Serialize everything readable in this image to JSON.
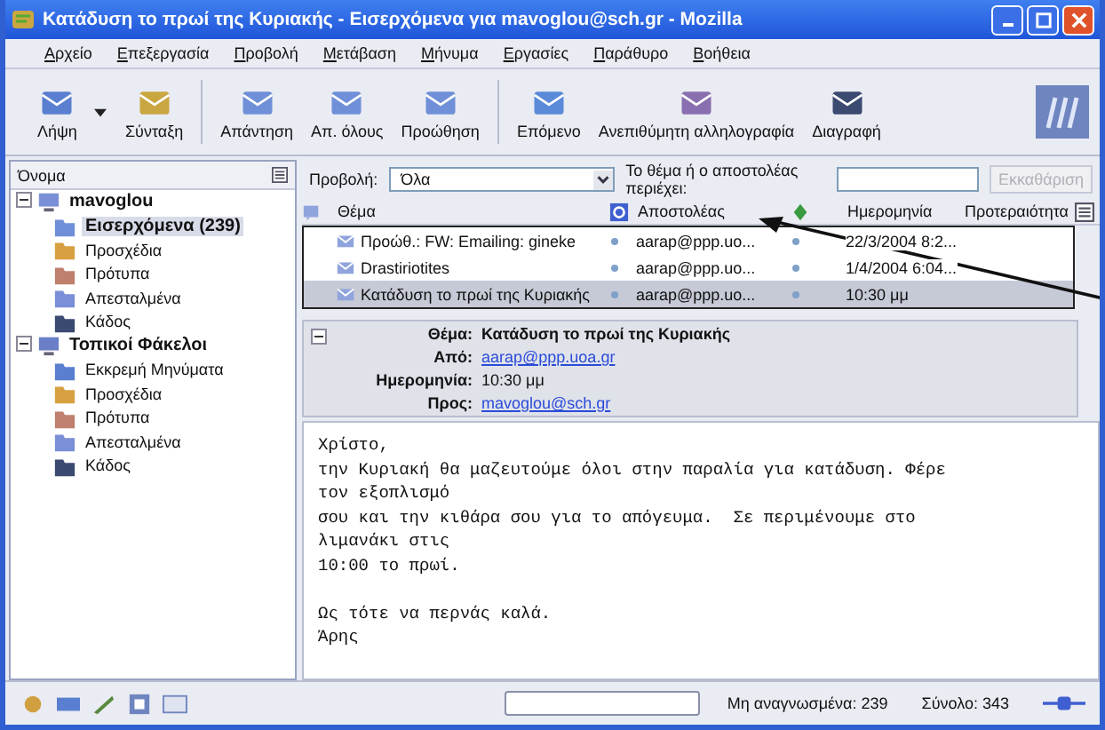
{
  "window": {
    "title": "Κατάδυση το πρωί της Κυριακής - Εισερχόμενα για mavoglou@sch.gr - Mozilla"
  },
  "menu": [
    "Αρχείο",
    "Επεξεργασία",
    "Προβολή",
    "Μετάβαση",
    "Μήνυμα",
    "Εργασίες",
    "Παράθυρο",
    "Βοήθεια"
  ],
  "toolbar": [
    {
      "label": "Λήψη",
      "kind": "get"
    },
    {
      "label": "Σύνταξη",
      "kind": "write"
    },
    {
      "label": "Απάντηση",
      "kind": "reply"
    },
    {
      "label": "Απ. όλους",
      "kind": "replyall"
    },
    {
      "label": "Προώθηση",
      "kind": "forward"
    },
    {
      "label": "Επόμενο",
      "kind": "next"
    },
    {
      "label": "Ανεπιθύμητη αλληλογραφία",
      "kind": "junk"
    },
    {
      "label": "Διαγραφή",
      "kind": "delete"
    }
  ],
  "folders": {
    "header": "Όνομα",
    "accounts": [
      {
        "name": "mavoglou",
        "kind": "account",
        "expanded": true,
        "children": [
          {
            "name": "Εισερχόμενα (239)",
            "kind": "inbox",
            "selected": true
          },
          {
            "name": "Προσχέδια",
            "kind": "drafts",
            "selected": false
          },
          {
            "name": "Πρότυπα",
            "kind": "templates",
            "selected": false
          },
          {
            "name": "Απεσταλμένα",
            "kind": "sent",
            "selected": false
          },
          {
            "name": "Κάδος",
            "kind": "trash",
            "selected": false
          }
        ]
      },
      {
        "name": "Τοπικοί Φάκελοι",
        "kind": "local",
        "expanded": true,
        "children": [
          {
            "name": "Εκκρεμή Μηνύματα",
            "kind": "outbox",
            "selected": false
          },
          {
            "name": "Προσχέδια",
            "kind": "drafts",
            "selected": false
          },
          {
            "name": "Πρότυπα",
            "kind": "templates",
            "selected": false
          },
          {
            "name": "Απεσταλμένα",
            "kind": "sent",
            "selected": false
          },
          {
            "name": "Κάδος",
            "kind": "trash",
            "selected": false
          }
        ]
      }
    ]
  },
  "filter": {
    "view_label": "Προβολή:",
    "view_value": "Όλα",
    "search_label": "Το θέμα ή ο αποστολέας περιέχει:",
    "clear_button": "Εκκαθάριση"
  },
  "message_list": {
    "columns": [
      "Θέμα",
      "Αποστολέας",
      "Ημερομηνία",
      "Προτεραιότητα"
    ],
    "rows": [
      {
        "subject": "Προώθ.: FW: Emailing: gineke",
        "sender": "aarap@ppp.uo...",
        "date": "22/3/2004 8:2...",
        "selected": false
      },
      {
        "subject": "Drastiriotites",
        "sender": "aarap@ppp.uo...",
        "date": "1/4/2004 6:04...",
        "selected": false
      },
      {
        "subject": "Κατάδυση το πρωί της Κυριακής",
        "sender": "aarap@ppp.uo...",
        "date": "10:30 μμ",
        "selected": true
      }
    ]
  },
  "message": {
    "fields": [
      {
        "label": "Θέμα:",
        "value": "Κατάδυση το πρωί της Κυριακής",
        "kind": "bold"
      },
      {
        "label": "Από:",
        "value": "aarap@ppp.uoa.gr",
        "kind": "link"
      },
      {
        "label": "Ημερομηνία:",
        "value": "10:30 μμ",
        "kind": "plain"
      },
      {
        "label": "Προς:",
        "value": "mavoglou@sch.gr",
        "kind": "link"
      }
    ],
    "body": "Χρίστο,\nτην Κυριακή θα μαζευτούμε όλοι στην παραλία για κατάδυση. Φέρε\nτον εξοπλισμό\nσου και την κιθάρα σου για το απόγευμα.  Σε περιμένουμε στο\nλιμανάκι στις\n10:00 το πρωί.\n\nΩς τότε να περνάς καλά.\nΆρης"
  },
  "status_bar": {
    "unread": "Μη αναγνωσμένα: 239",
    "total": "Σύνολο: 343"
  }
}
